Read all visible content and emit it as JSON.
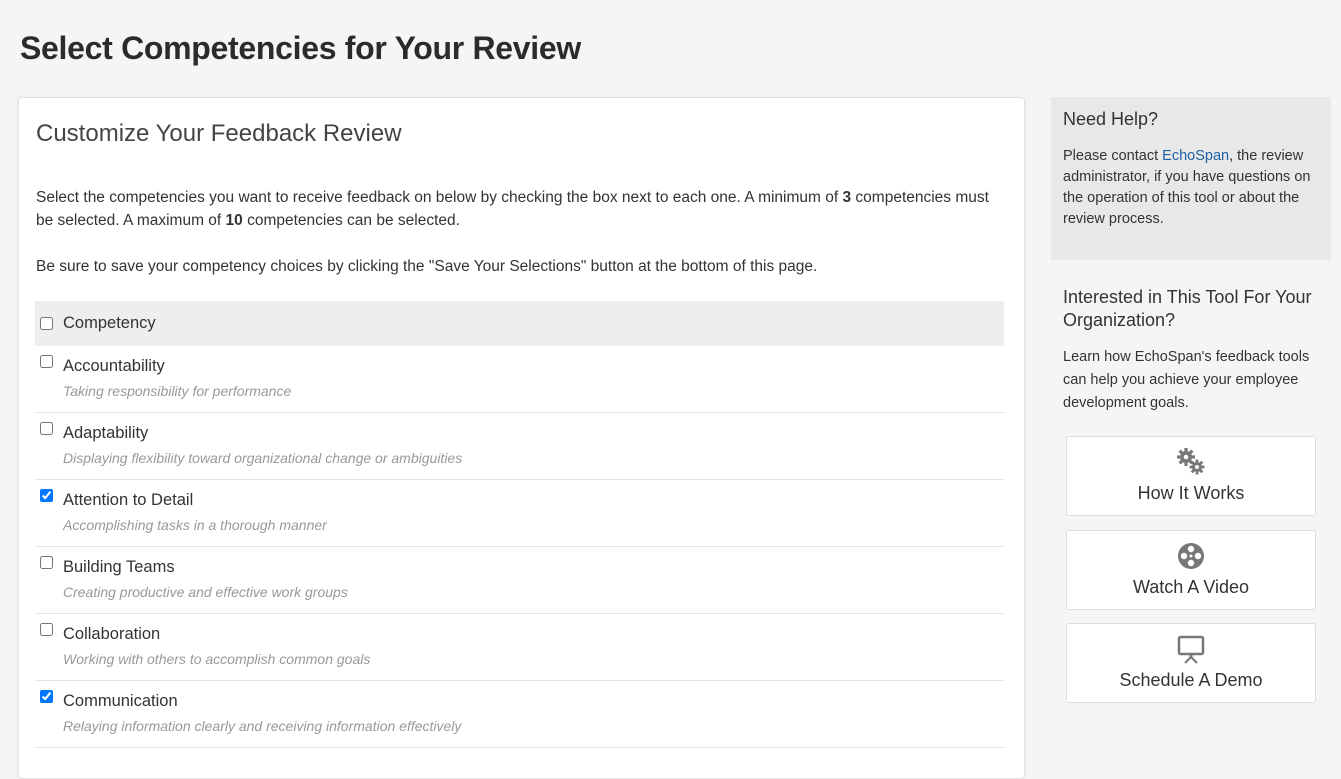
{
  "page": {
    "title": "Select Competencies for Your Review"
  },
  "main": {
    "card_title": "Customize Your Feedback Review",
    "intro": {
      "line1_before_min": "Select the competencies you want to receive feedback on below by checking the box next to each one. A minimum of ",
      "min": "3",
      "line1_after_min": " competencies must be selected. A maximum of ",
      "max": "10",
      "line1_after_max": " competencies can be selected.",
      "save_note": "Be sure to save your competency choices by clicking the \"Save Your Selections\" button at the bottom of this page."
    },
    "table": {
      "header_label": "Competency",
      "header_checked": false,
      "rows": [
        {
          "name": "Accountability",
          "description": "Taking responsibility for performance",
          "checked": false
        },
        {
          "name": "Adaptability",
          "description": "Displaying flexibility toward organizational change or ambiguities",
          "checked": false
        },
        {
          "name": "Attention to Detail",
          "description": "Accomplishing tasks in a thorough manner",
          "checked": true
        },
        {
          "name": "Building Teams",
          "description": "Creating productive and effective work groups",
          "checked": false
        },
        {
          "name": "Collaboration",
          "description": "Working with others to accomplish common goals",
          "checked": false
        },
        {
          "name": "Communication",
          "description": "Relaying information clearly and receiving information effectively",
          "checked": true
        }
      ]
    }
  },
  "sidebar": {
    "help": {
      "title": "Need Help?",
      "text_before_link": "Please contact ",
      "link_text": "EchoSpan",
      "text_after_link": ", the review administrator, if you have questions on the operation of this tool or about the review process."
    },
    "promo": {
      "title": "Interested in This Tool For Your Organization?",
      "text": "Learn how EchoSpan's feedback tools can help you achieve your employee development goals."
    },
    "buttons": [
      {
        "label": "How It Works",
        "icon": "gears-icon"
      },
      {
        "label": "Watch A Video",
        "icon": "film-reel-icon"
      },
      {
        "label": "Schedule A Demo",
        "icon": "presentation-screen-icon"
      }
    ]
  },
  "colors": {
    "background": "#f5f5f5",
    "link": "#1f5fa8",
    "checkbox_accent": "#0075ff",
    "description": "#999999",
    "help_box": "#e8e8e8"
  }
}
